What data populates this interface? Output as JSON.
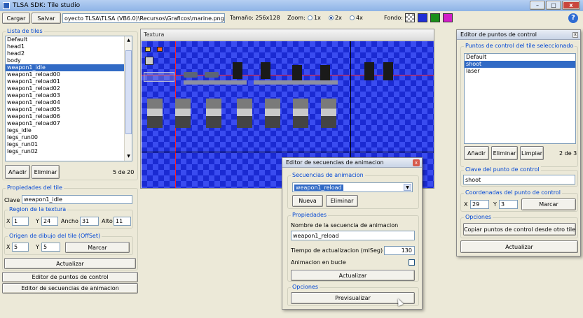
{
  "titlebar": {
    "title": "TLSA SDK: Tile studio"
  },
  "toolbar": {
    "load": "Cargar",
    "save": "Salvar",
    "path": "oyecto TLSA\\TLSA (VB6.0)\\Recursos\\Graficos\\marine.png",
    "size": "Tamaño: 256x128",
    "zoom_label": "Zoom:",
    "zoom_options": [
      "1x",
      "2x",
      "4x"
    ],
    "zoom_selected": "2x",
    "bg_label": "Fondo:",
    "bg_colors": [
      "#cccccc",
      "#1f2ed6",
      "#1a8f1a",
      "#d21fc8"
    ]
  },
  "tiles": {
    "legend": "Lista de tiles",
    "items": [
      "Default",
      "head1",
      "head2",
      "body",
      "weapon1_idle",
      "weapon1_reload00",
      "weapon1_reload01",
      "weapon1_reload02",
      "weapon1_reload03",
      "weapon1_reload04",
      "weapon1_reload05",
      "weapon1_reload06",
      "weapon1_reload07",
      "legs_idle",
      "legs_run00",
      "legs_run01",
      "legs_run02"
    ],
    "selected": "weapon1_idle",
    "add": "Añadir",
    "remove": "Eliminar",
    "count": "5 de 20"
  },
  "props": {
    "legend": "Propiedades del tile",
    "key_label": "Clave",
    "key_value": "weapon1_idle",
    "region_legend": "Region de la textura",
    "x_label": "X",
    "x": "1",
    "y_label": "Y",
    "y": "24",
    "w_label": "Ancho",
    "w": "31",
    "h_label": "Alto",
    "h": "11",
    "origin_legend": "Origen de dibujo del tile (OffSet)",
    "ox": "5",
    "oy": "5",
    "mark": "Marcar",
    "update": "Actualizar"
  },
  "nav": {
    "points_editor": "Editor de puntos de control",
    "anim_editor": "Editor de secuencias de animacion"
  },
  "texture": {
    "title": "Textura"
  },
  "control_points": {
    "title": "Editor de puntos de control",
    "legend": "Puntos de control del tile seleccionado",
    "items": [
      "Default",
      "shoot",
      "laser"
    ],
    "selected": "shoot",
    "add": "Añadir",
    "remove": "Eliminar",
    "clear": "Limpiar",
    "count": "2 de 3",
    "key_legend": "Clave del punto de control",
    "key_value": "shoot",
    "coords_legend": "Coordenadas del punto de control",
    "x_label": "X",
    "x": "29",
    "y_label": "Y",
    "y": "3",
    "mark": "Marcar",
    "options_legend": "Opciones",
    "copy": "Copiar puntos de control desde otro tile",
    "update": "Actualizar"
  },
  "anim": {
    "title": "Editor de secuencias de animacion",
    "seq_legend": "Secuencias de animacion",
    "selected": "weapon1_reload",
    "new": "Nueva",
    "remove": "Eliminar",
    "props_legend": "Propiedades",
    "name_label": "Nombre de la secuencia de animacion",
    "name_value": "weapon1_reload",
    "time_label": "Tiempo de actualizacion (mlSeg)",
    "time_value": "130",
    "loop_label": "Animacion en bucle",
    "update": "Actualizar",
    "options_legend": "Opciones",
    "preview": "Previsualizar"
  }
}
